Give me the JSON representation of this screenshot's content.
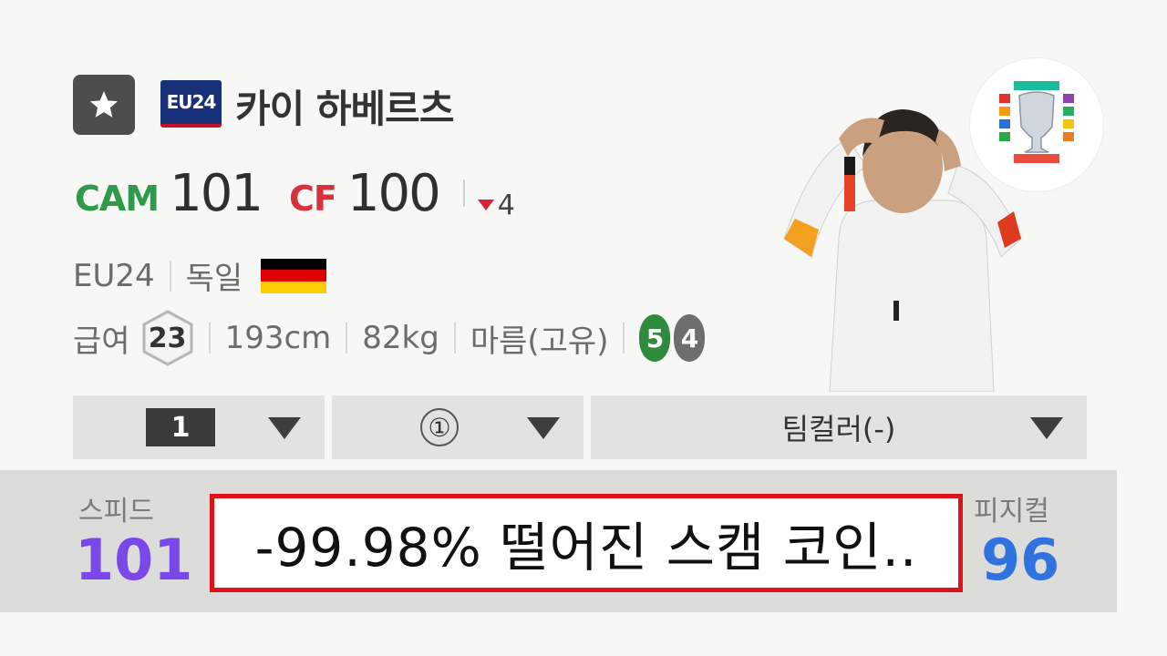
{
  "card": {
    "star_icon": "star-icon",
    "season_badge": "EU24",
    "name": "카이 하베르츠"
  },
  "positions": {
    "primary": {
      "pos": "CAM",
      "ovr": "101",
      "color": "#2e9a4a"
    },
    "secondary": {
      "pos": "CF",
      "ovr": "100",
      "color": "#d9313c"
    },
    "delta": "4"
  },
  "meta": {
    "season": "EU24",
    "nation": "독일",
    "flag_colors": [
      "#000000",
      "#dd0000",
      "#ffce00"
    ]
  },
  "meta2": {
    "pay_label": "급여",
    "pay_value": "23",
    "height": "193cm",
    "weight": "82kg",
    "body_type": "마름(고유)",
    "strong_foot": "5",
    "weak_foot": "4",
    "strong_foot_color": "#2e8b3e",
    "weak_foot_color": "#6e6e6e"
  },
  "dropdowns": {
    "level": "1",
    "reinforce": "①",
    "team_color": "팀컬러(-)"
  },
  "stats": {
    "left_label": "스피드",
    "left_value": "101",
    "left_color": "#7a47e8",
    "right_label": "피지컬",
    "right_value": "96",
    "right_color": "#2f72e0"
  },
  "callout": {
    "text": "-99.98% 떨어진 스캠 코인.."
  }
}
